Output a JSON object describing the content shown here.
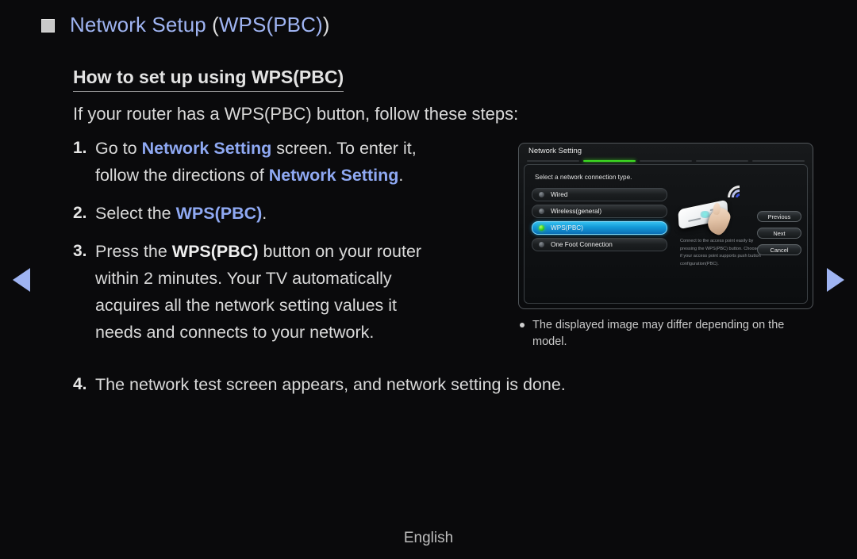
{
  "page": {
    "title_main": "Network Setup ",
    "title_paren_open": "(",
    "title_inner": "WPS(PBC)",
    "title_paren_close": ")",
    "bullet_icon": "square-bullet-icon",
    "section_heading": "How to set up using WPS(PBC)",
    "intro": "If your router has a WPS(PBC) button, follow these steps:",
    "footer_language": "English",
    "accent_blue": "#8fa9f3",
    "background": "#0a0a0c"
  },
  "nav": {
    "prev_icon": "left-triangle-arrow-icon",
    "next_icon": "right-triangle-arrow-icon"
  },
  "steps": [
    {
      "number": "1.",
      "line1_a": "Go to ",
      "line1_b": "Network Setting",
      "line1_c": " screen. To enter it,",
      "line2_a": "follow the directions of ",
      "line2_b": "Network Setting",
      "line2_c": "."
    },
    {
      "number": "2.",
      "line1_a": "Select the ",
      "line1_b": "WPS(PBC)",
      "line1_c": "."
    },
    {
      "number": "3.",
      "line1_a": "Press the ",
      "line1_b": "WPS(PBC)",
      "line1_c": " button on your router",
      "line2": "within 2 minutes. Your TV automatically",
      "line3": "acquires all the network setting values it",
      "line4": "needs and connects to your network."
    },
    {
      "number": "4.",
      "text": "The network test screen appears, and network setting is done."
    }
  ],
  "tv_mock": {
    "header_title": "Network Setting",
    "progress": {
      "segments": 5,
      "active_index": 1,
      "active_color": "#3ddc22"
    },
    "prompt": "Select a network connection type.",
    "connection_types": [
      {
        "label": "Wired",
        "selected": false
      },
      {
        "label": "Wireless(general)",
        "selected": false
      },
      {
        "label": "WPS(PBC)",
        "selected": true
      },
      {
        "label": "One Foot Connection",
        "selected": false
      }
    ],
    "illustration": {
      "router_icon": "wireless-router-icon",
      "wifi_icon": "wifi-signal-icon",
      "hand_icon": "pointing-hand-icon"
    },
    "description": "Connect to the access point easily by pressing the WPS(PBC) button. Choose this if your access point supports push button configuration(PBC).",
    "buttons": [
      {
        "label": "Previous"
      },
      {
        "label": "Next"
      },
      {
        "label": "Cancel"
      }
    ]
  },
  "note": {
    "bullet_icon": "dot-bullet-icon",
    "text": "The displayed image may differ depending on the model."
  }
}
